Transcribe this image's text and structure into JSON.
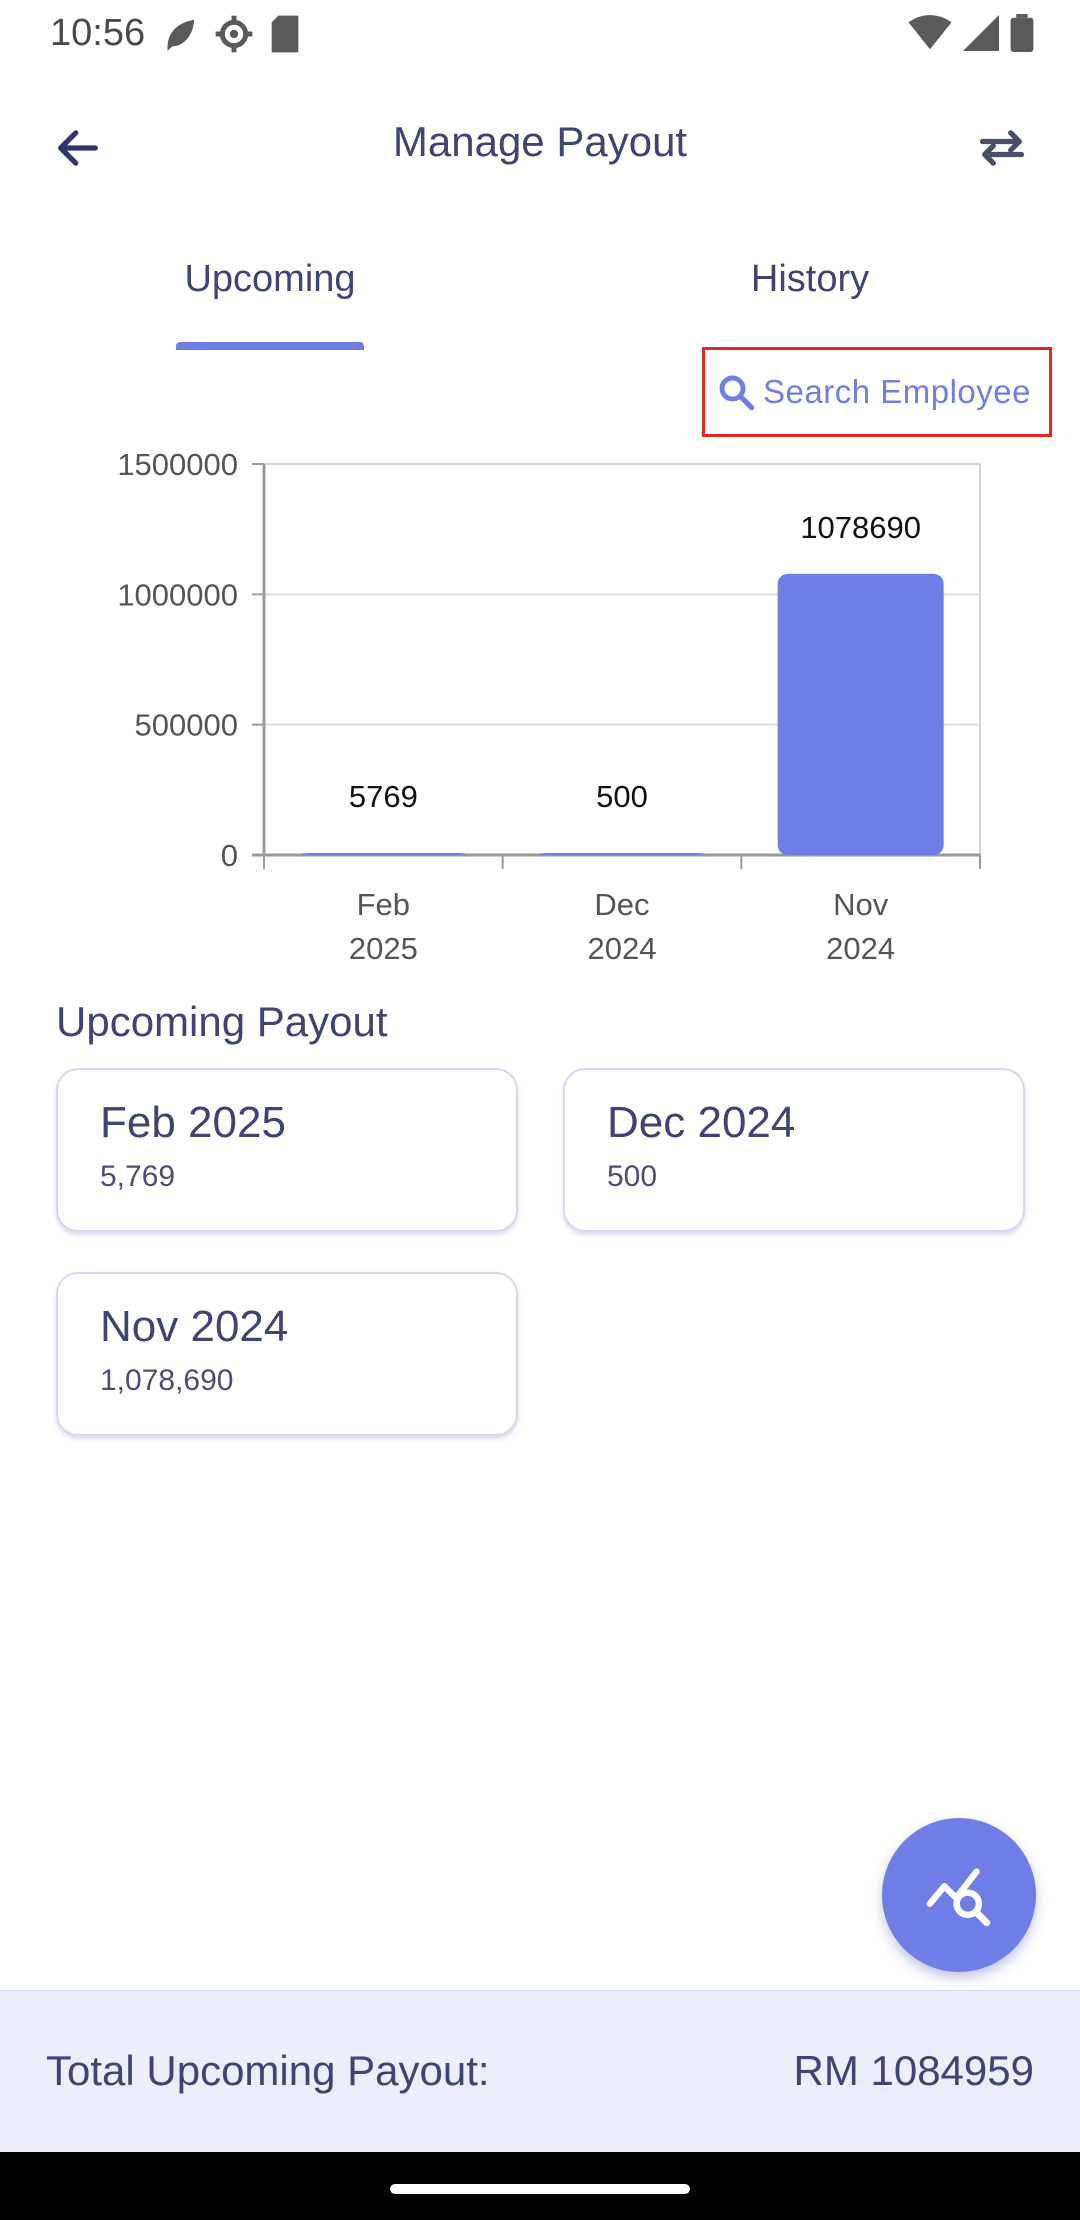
{
  "status_bar": {
    "time": "10:56"
  },
  "app_bar": {
    "title": "Manage Payout"
  },
  "tabs": [
    {
      "label": "Upcoming",
      "selected": true
    },
    {
      "label": "History",
      "selected": false
    }
  ],
  "search": {
    "label": "Search Employee"
  },
  "chart_data": {
    "type": "bar",
    "categories": [
      "Feb 2025",
      "Dec 2024",
      "Nov 2024"
    ],
    "category_lines": [
      [
        "Feb",
        "2025"
      ],
      [
        "Dec",
        "2024"
      ],
      [
        "Nov",
        "2024"
      ]
    ],
    "values": [
      5769,
      500,
      1078690
    ],
    "data_labels": [
      "5769",
      "500",
      "1078690"
    ],
    "y_ticks": [
      0,
      500000,
      1000000,
      1500000
    ],
    "ylim": [
      0,
      1500000
    ],
    "bar_color": "#6f7ee6",
    "grid": true
  },
  "section": {
    "title": "Upcoming Payout"
  },
  "cards": [
    {
      "title": "Feb 2025",
      "amount": "5,769"
    },
    {
      "title": "Dec 2024",
      "amount": "500"
    },
    {
      "title": "Nov 2024",
      "amount": "1,078,690"
    }
  ],
  "fab": {
    "icon": "chart-search-icon"
  },
  "total": {
    "label": "Total Upcoming Payout:",
    "value": "RM 1084959"
  },
  "colors": {
    "accent": "#6f7ee6",
    "text": "#3e4474",
    "total_bg": "#eceefb"
  }
}
